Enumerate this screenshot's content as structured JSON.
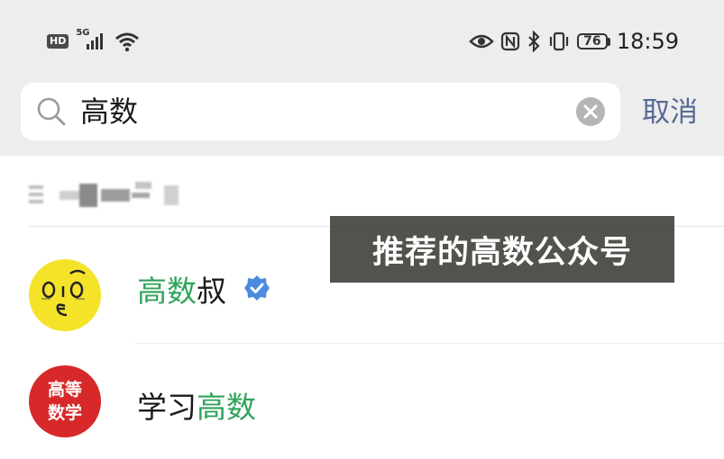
{
  "status_bar": {
    "hd": "HD",
    "network": "5G",
    "battery": "76",
    "time": "18:59"
  },
  "search": {
    "query": "高数",
    "cancel_label": "取消"
  },
  "results": [
    {
      "highlight": "高数",
      "rest": "叔",
      "verified": true,
      "avatar_color": "#f5e32a"
    },
    {
      "prefix": "学习",
      "highlight": "高数",
      "verified": false,
      "avatar_color": "#d7282a",
      "avatar_text_1": "高等",
      "avatar_text_2": "数学"
    }
  ],
  "overlay": {
    "text": "推荐的高数公众号"
  },
  "colors": {
    "highlight": "#2fa35a",
    "link": "#576b95",
    "verified_badge": "#4a8be0"
  }
}
